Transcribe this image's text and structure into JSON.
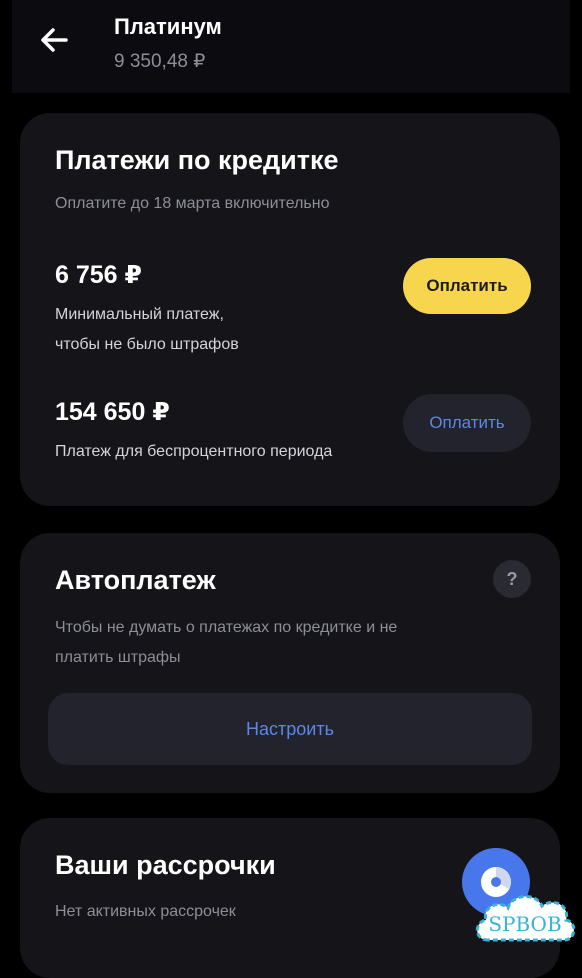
{
  "header": {
    "title": "Платинум",
    "balance": "9 350,48 ₽",
    "back_icon": "arrow-left-icon"
  },
  "payments": {
    "title": "Платежи по кредитке",
    "due_text": "Оплатите до 18 марта включительно",
    "minimum": {
      "amount": "6 756 ₽",
      "caption_line1": "Минимальный платеж,",
      "caption_line2": "чтобы не было штрафов",
      "button_label": "Оплатить"
    },
    "grace": {
      "amount": "154 650 ₽",
      "caption": "Платеж для беспроцентного периода",
      "button_label": "Оплатить"
    }
  },
  "autopay": {
    "title": "Автоплатеж",
    "help_label": "?",
    "description_line1": "Чтобы не думать о платежах по кредитке и не",
    "description_line2": "платить штрафы",
    "setup_label": "Настроить"
  },
  "installments": {
    "title": "Ваши рассрочки",
    "description": "Нет активных рассрочек",
    "fab_icon": "chat-icon"
  },
  "watermark": {
    "text": "SPBOB"
  },
  "colors": {
    "background": "#000000",
    "card": "#141419",
    "accent_yellow": "#f7d64d",
    "link_blue": "#5c87e6",
    "fab_blue": "#4877ec",
    "muted_text": "#8e8e99"
  }
}
